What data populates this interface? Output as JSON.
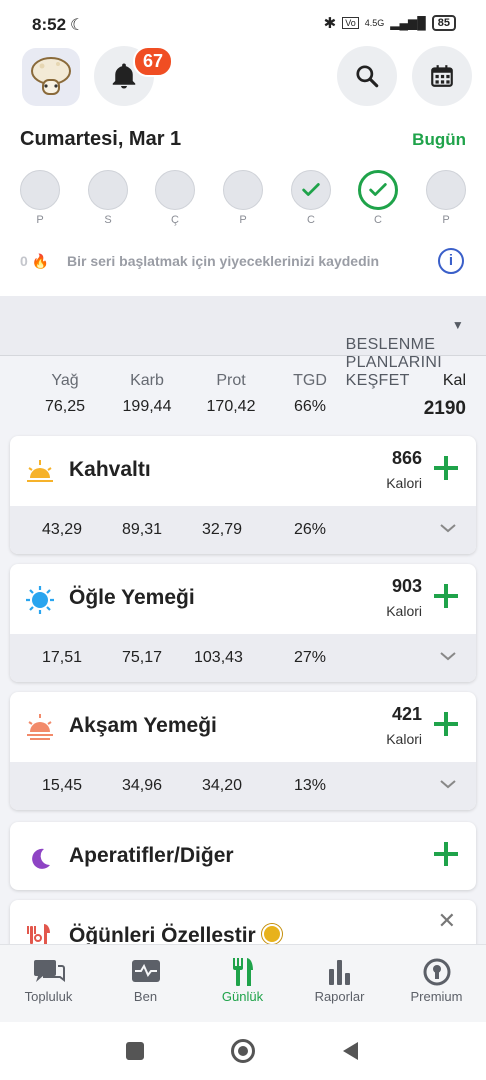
{
  "status_bar": {
    "time": "8:52",
    "network": "4.5G",
    "battery": "85"
  },
  "header": {
    "notification_count": "67",
    "date": "Cumartesi, Mar 1",
    "today_label": "Bugün"
  },
  "week": {
    "days": [
      {
        "label": "P",
        "state": "empty"
      },
      {
        "label": "S",
        "state": "empty"
      },
      {
        "label": "Ç",
        "state": "empty"
      },
      {
        "label": "P",
        "state": "empty"
      },
      {
        "label": "C",
        "state": "checked"
      },
      {
        "label": "C",
        "state": "selected"
      },
      {
        "label": "P",
        "state": "empty"
      }
    ]
  },
  "streak": {
    "count": "0",
    "text": "Bir seri başlatmak için yiyeceklerinizi kaydedin"
  },
  "explore_label": "BESLENME PLANLARINI KEŞFET",
  "totals": {
    "fat_label": "Yağ",
    "fat": "76,25",
    "carb_label": "Karb",
    "carb": "199,44",
    "prot_label": "Prot",
    "prot": "170,42",
    "tgd_label": "TGD",
    "tgd": "66%",
    "kcal_label": "Kal",
    "kcal": "2190"
  },
  "meals": [
    {
      "name": "Kahvaltı",
      "kcal": "866",
      "unit": "Kalori",
      "fat": "43,29",
      "carb": "89,31",
      "prot": "32,79",
      "pct": "26%"
    },
    {
      "name": "Öğle Yemeği",
      "kcal": "903",
      "unit": "Kalori",
      "fat": "17,51",
      "carb": "75,17",
      "prot": "103,43",
      "pct": "27%"
    },
    {
      "name": "Akşam Yemeği",
      "kcal": "421",
      "unit": "Kalori",
      "fat": "15,45",
      "carb": "34,96",
      "prot": "34,20",
      "pct": "13%"
    },
    {
      "name": "Aperatifler/Diğer"
    }
  ],
  "customize": {
    "title": "Öğünleri Özellestir"
  },
  "nav": {
    "community": "Topluluk",
    "me": "Ben",
    "daily": "Günlük",
    "reports": "Raporlar",
    "premium": "Premium"
  },
  "colors": {
    "accent": "#1fa34a",
    "badge": "#f04e23"
  }
}
